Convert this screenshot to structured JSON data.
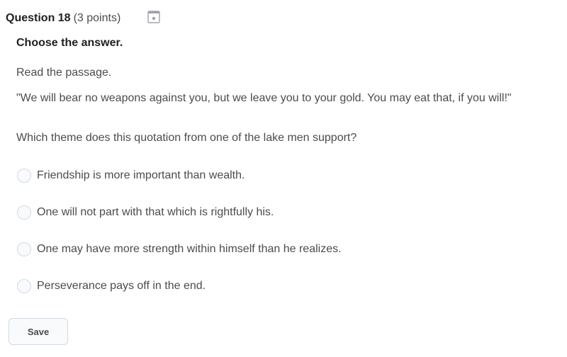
{
  "question": {
    "number_label": "Question 18",
    "points_label": "(3 points)",
    "flag_icon": "bookmark-flag-icon",
    "instruction": "Choose the answer.",
    "read_text": "Read the passage.",
    "quote": "\"We will bear no weapons against you, but we leave you to your gold. You may eat that, if you will!\"",
    "prompt": "Which theme does this quotation from one of the lake men support?",
    "options": [
      {
        "label": "Friendship is more important than wealth.",
        "selected": false
      },
      {
        "label": "One will not part with that which is rightfully his.",
        "selected": false
      },
      {
        "label": "One may have more strength within himself than he realizes.",
        "selected": false
      },
      {
        "label": "Perseverance pays off in the end.",
        "selected": false
      }
    ]
  },
  "actions": {
    "save_label": "Save"
  },
  "colors": {
    "text": "#494c4e",
    "heading": "#202122",
    "border": "#d3d9e3",
    "control_bg": "#f9fafb"
  }
}
